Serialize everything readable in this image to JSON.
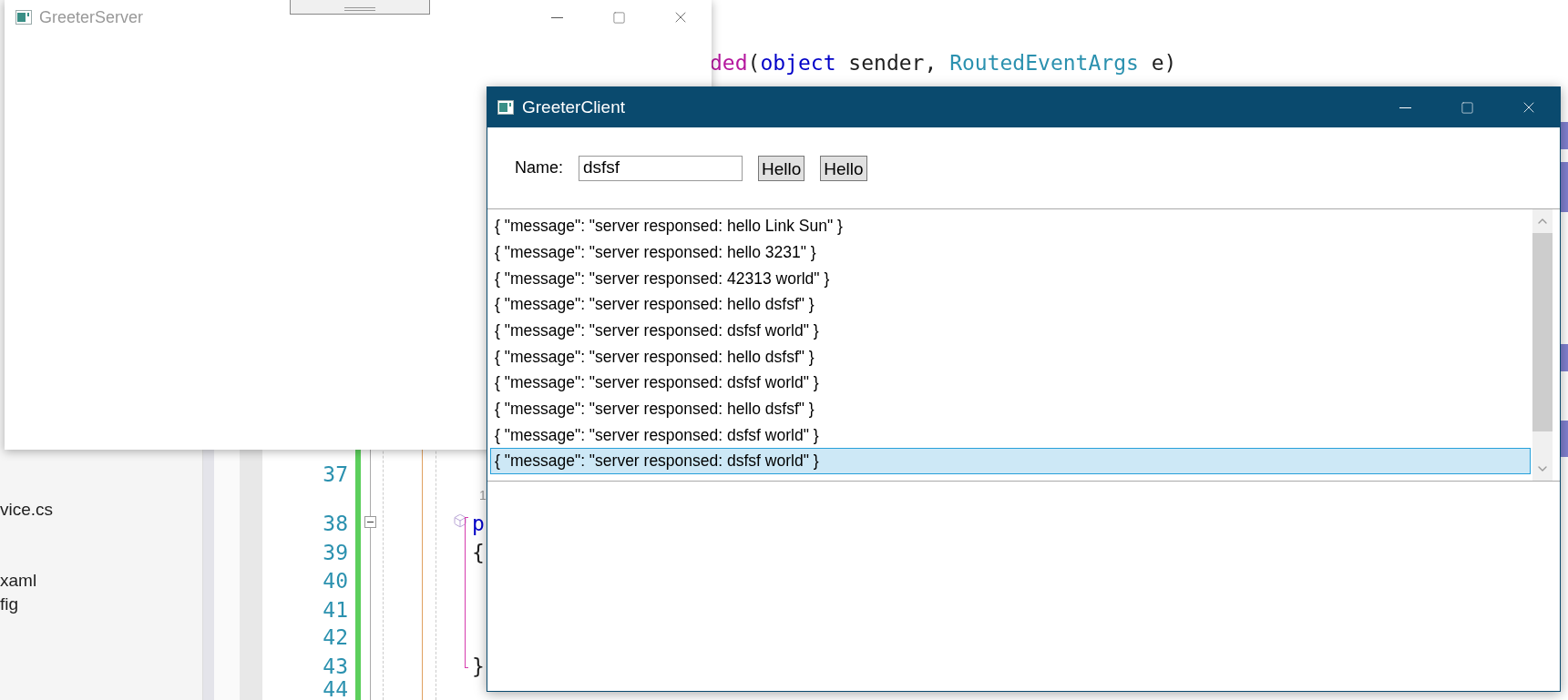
{
  "ide": {
    "explorer_items": [
      {
        "label": "vice.cs"
      },
      {
        "label": "xaml"
      },
      {
        "label": "fig"
      }
    ],
    "code_line": [
      {
        "kind": "method",
        "text": "ded"
      },
      {
        "kind": "plain",
        "text": "("
      },
      {
        "kind": "keyword",
        "text": "object"
      },
      {
        "kind": "plain",
        "text": " sender, "
      },
      {
        "kind": "type",
        "text": "RoutedEventArgs"
      },
      {
        "kind": "plain",
        "text": " e)"
      }
    ],
    "line_numbers": [
      "37",
      "38",
      "39",
      "40",
      "41",
      "42",
      "43",
      "44"
    ],
    "codelens": "1",
    "code_fragments": [
      {
        "kind": "keyword",
        "text": "p"
      },
      {
        "kind": "plain",
        "text": "{"
      },
      {
        "kind": "plain",
        "text": "}"
      }
    ]
  },
  "server_window": {
    "title": "GreeterServer",
    "active": false
  },
  "client_window": {
    "title": "GreeterClient",
    "active": true,
    "name_label": "Name:",
    "name_value": "dsfsf",
    "buttons": [
      "Hello",
      "Hello"
    ],
    "messages": [
      {
        "text": "{ \"message\": \"server responsed: hello Link Sun\" }",
        "selected": false
      },
      {
        "text": "{ \"message\": \"server responsed: hello 3231\" }",
        "selected": false
      },
      {
        "text": "{ \"message\": \"server responsed: 42313 world\" }",
        "selected": false
      },
      {
        "text": "{ \"message\": \"server responsed: hello dsfsf\" }",
        "selected": false
      },
      {
        "text": "{ \"message\": \"server responsed: dsfsf world\" }",
        "selected": false
      },
      {
        "text": "{ \"message\": \"server responsed: hello dsfsf\" }",
        "selected": false
      },
      {
        "text": "{ \"message\": \"server responsed: dsfsf world\" }",
        "selected": false
      },
      {
        "text": "{ \"message\": \"server responsed: hello dsfsf\" }",
        "selected": false
      },
      {
        "text": "{ \"message\": \"server responsed: dsfsf world\" }",
        "selected": false
      },
      {
        "text": "{ \"message\": \"server responsed: dsfsf world\" }",
        "selected": true
      }
    ]
  }
}
